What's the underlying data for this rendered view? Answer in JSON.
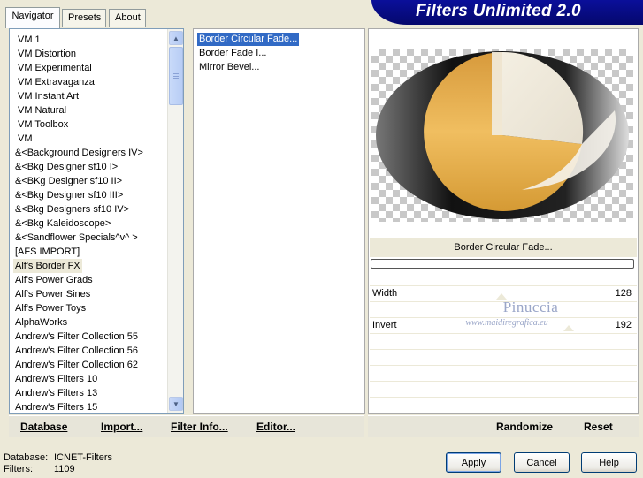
{
  "tabs": [
    {
      "label": "Navigator",
      "active": true
    },
    {
      "label": "Presets",
      "active": false
    },
    {
      "label": "About",
      "active": false
    }
  ],
  "title": "Filters Unlimited 2.0",
  "categories": [
    "VM 1",
    "VM Distortion",
    "VM Experimental",
    "VM Extravaganza",
    "VM Instant Art",
    "VM Natural",
    "VM Toolbox",
    "VM",
    "&<Background Designers IV>",
    "&<Bkg Designer sf10 I>",
    "&<BKg Designer sf10 II>",
    "&<Bkg Designer sf10 III>",
    "&<Bkg Designers sf10 IV>",
    "&<Bkg Kaleidoscope>",
    "&<Sandflower Specials^v^ >",
    "[AFS IMPORT]",
    "Alf's Border FX",
    "Alf's Power Grads",
    "Alf's Power Sines",
    "Alf's Power Toys",
    "AlphaWorks",
    "Andrew's Filter Collection 55",
    "Andrew's Filter Collection 56",
    "Andrew's Filter Collection 62",
    "Andrew's Filters 10",
    "Andrew's Filters 13",
    "Andrew's Filters 15"
  ],
  "selected_category": "Alf's Border FX",
  "filters": [
    "Border Circular Fade...",
    "Border Fade I...",
    "Mirror Bevel..."
  ],
  "selected_filter": "Border Circular Fade...",
  "preview_filter_name": "Border Circular Fade...",
  "params": [
    {
      "label": "Width",
      "value": "128"
    },
    {
      "label": "Invert",
      "value": "192"
    }
  ],
  "watermark": {
    "name": "Pinuccia",
    "url": "www.maidiregrafica.eu"
  },
  "left_toolbar": {
    "database": "Database",
    "import": "Import...",
    "filter_info": "Filter Info...",
    "editor": "Editor..."
  },
  "right_toolbar": {
    "randomize": "Randomize",
    "reset": "Reset"
  },
  "info": {
    "database_label": "Database:",
    "database_value": "ICNET-Filters",
    "filters_label": "Filters:",
    "filters_value": "1109"
  },
  "buttons": {
    "apply": "Apply",
    "cancel": "Cancel",
    "help": "Help"
  },
  "colors": {
    "title_bar": "#05086d",
    "selection": "#316ac5",
    "preview_gold": "#e8b04c"
  }
}
